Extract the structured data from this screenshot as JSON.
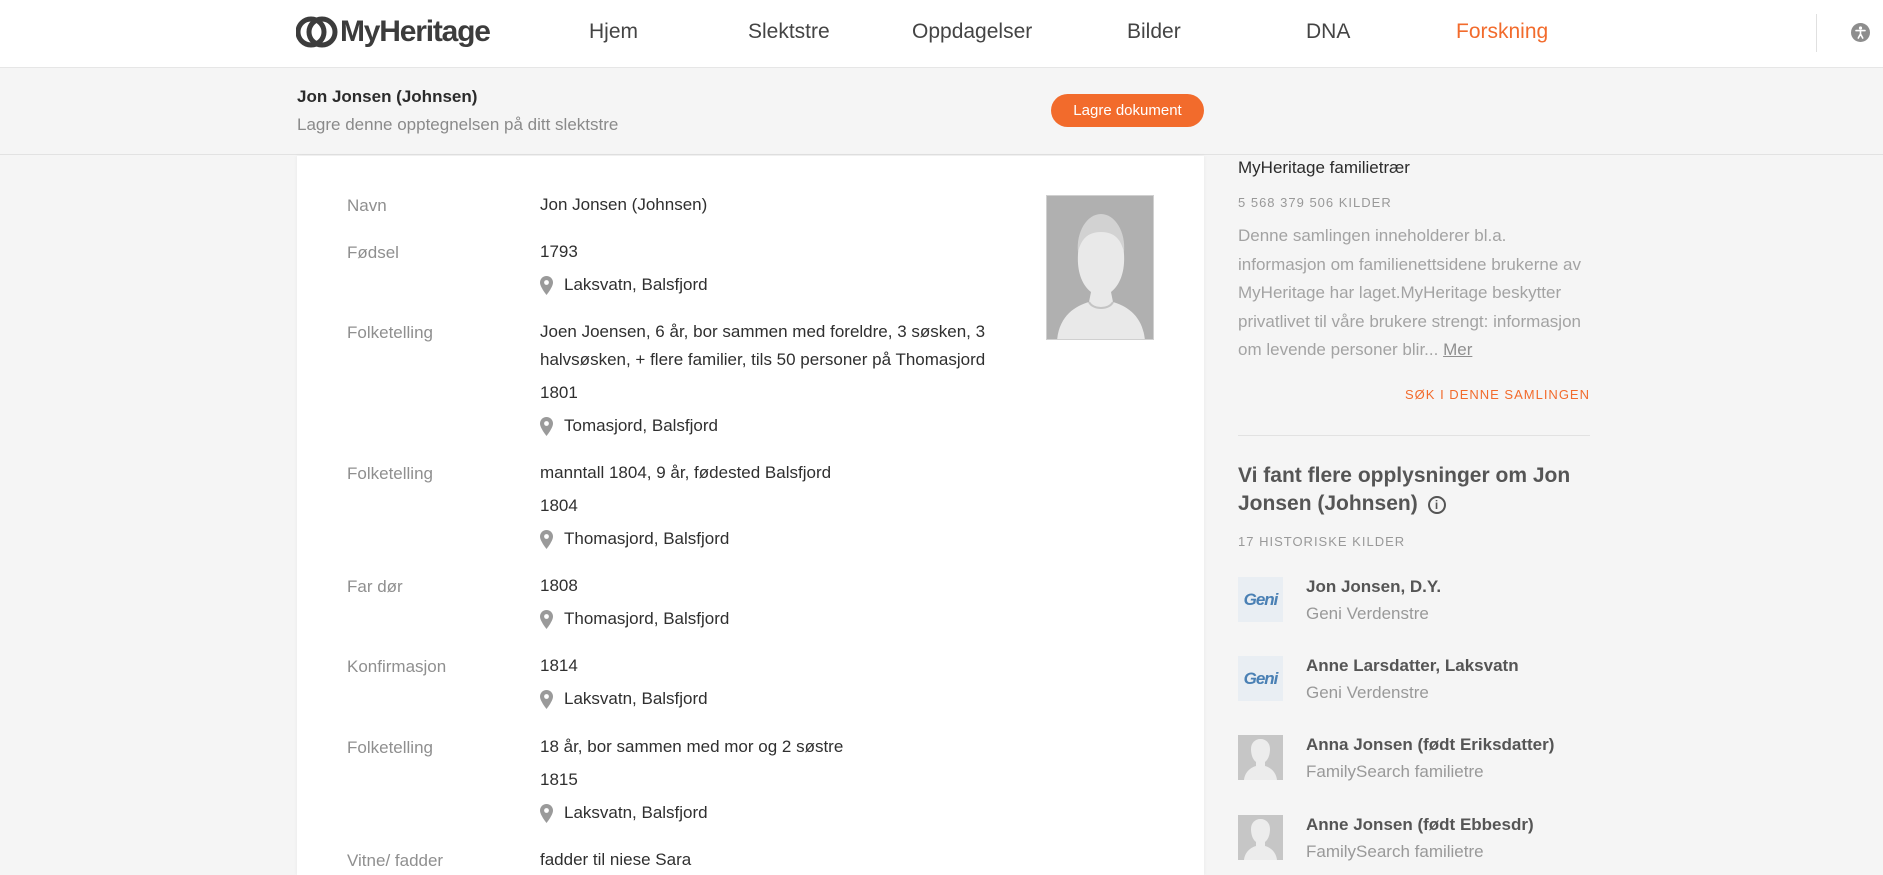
{
  "nav": {
    "logo_text": "MyHeritage",
    "items": [
      {
        "label": "Hjem"
      },
      {
        "label": "Slektstre"
      },
      {
        "label": "Oppdagelser"
      },
      {
        "label": "Bilder"
      },
      {
        "label": "DNA"
      },
      {
        "label": "Forskning"
      }
    ],
    "active_item": "Forskning",
    "accent_color": "#f26b2c"
  },
  "subheader": {
    "title": "Jon Jonsen (Johnsen)",
    "description": "Lagre denne opptegnelsen på ditt slektstre",
    "save_button_label": "Lagre dokument"
  },
  "record": {
    "photo_icon": "silhouette-male-icon",
    "rows": [
      {
        "label": "Navn",
        "lines": [
          {
            "text": "Jon Jonsen (Johnsen)"
          }
        ]
      },
      {
        "label": "Fødsel",
        "lines": [
          {
            "text": "1793"
          },
          {
            "text": "Laksvatn, Balsfjord",
            "place": true
          }
        ]
      },
      {
        "label": "Folketelling",
        "lines": [
          {
            "text": "Joen Joensen, 6 år, bor sammen med foreldre, 3 søsken, 3 halvsøsken, + flere familier, tils 50 personer på Thomasjord"
          },
          {
            "text": "1801"
          },
          {
            "text": "Tomasjord, Balsfjord",
            "place": true
          }
        ]
      },
      {
        "label": "Folketelling",
        "lines": [
          {
            "text": "manntall 1804, 9 år, fødested Balsfjord"
          },
          {
            "text": "1804"
          },
          {
            "text": "Thomasjord, Balsfjord",
            "place": true
          }
        ]
      },
      {
        "label": "Far dør",
        "lines": [
          {
            "text": "1808"
          },
          {
            "text": "Thomasjord, Balsfjord",
            "place": true
          }
        ]
      },
      {
        "label": "Konfirmasjon",
        "lines": [
          {
            "text": "1814"
          },
          {
            "text": "Laksvatn, Balsfjord",
            "place": true
          }
        ]
      },
      {
        "label": "Folketelling",
        "lines": [
          {
            "text": "18 år, bor sammen med mor og 2 søstre"
          },
          {
            "text": "1815"
          },
          {
            "text": "Laksvatn, Balsfjord",
            "place": true
          }
        ]
      },
      {
        "label": "Vitne/ fadder",
        "lines": [
          {
            "text": "fadder til niese Sara"
          }
        ]
      }
    ]
  },
  "sidebar": {
    "collection_title": "MyHeritage familietrær",
    "collection_count": "5 568 379 506 KILDER",
    "collection_desc": "Denne samlingen inneholderer bl.a. informasjon om familienettsidene brukerne av MyHeritage har laget.MyHeritage beskytter privatlivet til våre brukere strengt: informasjon om levende personer blir...",
    "more_label": "Mer",
    "search_label": "SØK I DENNE SAMLINGEN",
    "matches_heading": "Vi fant flere opplysninger om Jon Jonsen (Johnsen)",
    "matches_count": "17 HISTORISKE KILDER",
    "matches": [
      {
        "name": "Jon Jonsen, D.Y.",
        "source": "Geni Verdenstre",
        "thumb": "geni",
        "thumb_text": "Geni"
      },
      {
        "name": "Anne Larsdatter, Laksvatn",
        "source": "Geni Verdenstre",
        "thumb": "geni",
        "thumb_text": "Geni"
      },
      {
        "name": "Anna Jonsen (født Eriksdatter)",
        "source": "FamilySearch familietre",
        "thumb": "person",
        "thumb_text": ""
      },
      {
        "name": "Anne Jonsen (født Ebbesdr)",
        "source": "FamilySearch familietre",
        "thumb": "person",
        "thumb_text": ""
      }
    ]
  }
}
